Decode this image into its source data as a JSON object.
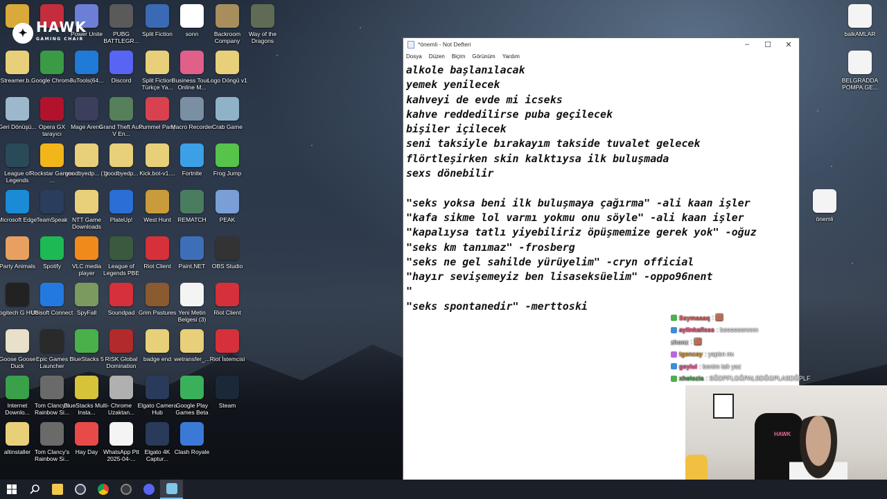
{
  "brand": {
    "logo_text": "HAWK",
    "logo_sub": "GAMING CHAIR"
  },
  "desktop": {
    "icons": [
      {
        "id": "i01",
        "label": "",
        "color": "#d9a93a"
      },
      {
        "id": "i02",
        "label": "",
        "color": "#c42d3b"
      },
      {
        "id": "i03",
        "label": "Power Unite",
        "color": "#6b7fd6"
      },
      {
        "id": "i04",
        "label": "PUBG BATTLEGR...",
        "color": "#5a5a5a"
      },
      {
        "id": "i05",
        "label": "Split Fiction",
        "color": "#3a6ab3"
      },
      {
        "id": "i06",
        "label": "sonn",
        "color": "#ffffff"
      },
      {
        "id": "i07",
        "label": "Backroom Company",
        "color": "#a78e5c"
      },
      {
        "id": "i08",
        "label": "Way of the Dragons",
        "color": "#5f6b55"
      },
      {
        "id": "i09",
        "label": "Streamer.b...",
        "color": "#e8d07a"
      },
      {
        "id": "i10",
        "label": "Google Chrome",
        "color": "#3b9a45"
      },
      {
        "id": "i11",
        "label": "3uTools(64...",
        "color": "#1f7ad8"
      },
      {
        "id": "i12",
        "label": "Discord",
        "color": "#5865f2"
      },
      {
        "id": "i13",
        "label": "Split Fiction Türkçe Ya...",
        "color": "#e8d07a"
      },
      {
        "id": "i14",
        "label": "Business Tour - Online M...",
        "color": "#e0608a"
      },
      {
        "id": "i15",
        "label": "Logo Döngü v1",
        "color": "#e8d07a"
      },
      {
        "id": "i16",
        "label": "Geri Dönüşü...",
        "color": "#9db8cc"
      },
      {
        "id": "i17",
        "label": "Opera GX tarayıcı",
        "color": "#b3122c"
      },
      {
        "id": "i18",
        "label": "Mage Arena",
        "color": "#3b3f5c"
      },
      {
        "id": "i19",
        "label": "Grand Theft Auto V En...",
        "color": "#55805a"
      },
      {
        "id": "i20",
        "label": "Pummel Party",
        "color": "#d8424f"
      },
      {
        "id": "i21",
        "label": "Macro Recorder",
        "color": "#7b8fa3"
      },
      {
        "id": "i22",
        "label": "Crab Game",
        "color": "#8fb2c9"
      },
      {
        "id": "i23",
        "label": "League of Legends",
        "color": "#2b4a59"
      },
      {
        "id": "i24",
        "label": "Rockstar Games ...",
        "color": "#f2b61a"
      },
      {
        "id": "i25",
        "label": "goodbyedp... (1)",
        "color": "#e8d07a"
      },
      {
        "id": "i26",
        "label": "goodbyedp...",
        "color": "#e8d07a"
      },
      {
        "id": "i27",
        "label": "Kick.bot-v1....",
        "color": "#e8d07a"
      },
      {
        "id": "i28",
        "label": "Fortnite",
        "color": "#3ca0e6"
      },
      {
        "id": "i29",
        "label": "Frog Jump",
        "color": "#56c34a"
      },
      {
        "id": "i30",
        "label": "Microsoft Edge",
        "color": "#1a8bd6"
      },
      {
        "id": "i31",
        "label": "TeamSpeak",
        "color": "#2a3d5c"
      },
      {
        "id": "i32",
        "label": "NTT Game Downloads",
        "color": "#e8d07a"
      },
      {
        "id": "i33",
        "label": "PlateUp!",
        "color": "#2b6fd6"
      },
      {
        "id": "i34",
        "label": "West Hunt",
        "color": "#c99b3a"
      },
      {
        "id": "i35",
        "label": "REMATCH",
        "color": "#4a7d5f"
      },
      {
        "id": "i36",
        "label": "PEAK",
        "color": "#7a9fd6"
      },
      {
        "id": "i37",
        "label": "Party Animals",
        "color": "#e8a060"
      },
      {
        "id": "i38",
        "label": "Spotify",
        "color": "#1db954"
      },
      {
        "id": "i39",
        "label": "VLC media player",
        "color": "#f08a1a"
      },
      {
        "id": "i40",
        "label": "League of Legends PBE",
        "color": "#3a5a3f"
      },
      {
        "id": "i41",
        "label": "Riot Client",
        "color": "#d6303a"
      },
      {
        "id": "i42",
        "label": "Paint.NET",
        "color": "#3d6fb8"
      },
      {
        "id": "i43",
        "label": "OBS Studio",
        "color": "#333333"
      },
      {
        "id": "i44",
        "label": "Logitech G HUB",
        "color": "#222222"
      },
      {
        "id": "i45",
        "label": "Ubisoft Connect",
        "color": "#2479e0"
      },
      {
        "id": "i46",
        "label": "SpyFall",
        "color": "#7a9a60"
      },
      {
        "id": "i47",
        "label": "Soundpad",
        "color": "#d6303a"
      },
      {
        "id": "i48",
        "label": "Grim Pastures",
        "color": "#8a5a30"
      },
      {
        "id": "i49",
        "label": "Yeni Metin Belgesi (3)",
        "color": "#f4f4f4"
      },
      {
        "id": "i50",
        "label": "Riot Client",
        "color": "#d6303a"
      },
      {
        "id": "i51",
        "label": "Goose Goose Duck",
        "color": "#e8e0c8"
      },
      {
        "id": "i52",
        "label": "Epic Games Launcher",
        "color": "#2a2a2a"
      },
      {
        "id": "i53",
        "label": "BlueStacks 5",
        "color": "#4ab04a"
      },
      {
        "id": "i54",
        "label": "RISK Global Domination",
        "color": "#b32a2a"
      },
      {
        "id": "i55",
        "label": "badge end",
        "color": "#e8d07a"
      },
      {
        "id": "i56",
        "label": "wetransfer_...",
        "color": "#e8d07a"
      },
      {
        "id": "i57",
        "label": "Riot İstemcisi",
        "color": "#d6303a"
      },
      {
        "id": "i58",
        "label": "Internet Downlo...",
        "color": "#3aa04a"
      },
      {
        "id": "i59",
        "label": "Tom Clancy's Rainbow Si...",
        "color": "#6a6a6a"
      },
      {
        "id": "i60",
        "label": "BlueStacks Multi-Insta...",
        "color": "#d6c33a"
      },
      {
        "id": "i61",
        "label": "Chrome Uzaktan...",
        "color": "#b0b0b0"
      },
      {
        "id": "i62",
        "label": "Elgato Camera Hub",
        "color": "#2a3a5a"
      },
      {
        "id": "i63",
        "label": "Google Play Games Beta",
        "color": "#3ab05a"
      },
      {
        "id": "i64",
        "label": "Steam",
        "color": "#1b2838"
      },
      {
        "id": "i65",
        "label": "altinstaller",
        "color": "#e8d07a"
      },
      {
        "id": "i66",
        "label": "Tom Clancy's Rainbow Si...",
        "color": "#6a6a6a"
      },
      {
        "id": "i67",
        "label": "Hay Day",
        "color": "#e84a4a"
      },
      {
        "id": "i68",
        "label": "WhatsApp Ptt 2025-04-...",
        "color": "#f4f4f4"
      },
      {
        "id": "i69",
        "label": "Elgato 4K Captur...",
        "color": "#2a3a5a"
      },
      {
        "id": "i70",
        "label": "Clash Royale",
        "color": "#3a7ad6"
      },
      {
        "id": "r1",
        "label": "balkAMLAR",
        "color": "#f4f4f4"
      },
      {
        "id": "r2",
        "label": "BELGRADDA POMPA.GE...",
        "color": "#f4f4f4"
      },
      {
        "id": "r3",
        "label": "önemli",
        "color": "#f4f4f4"
      }
    ]
  },
  "notepad": {
    "title": "*önemli - Not Defteri",
    "menu": [
      "Dosya",
      "Düzen",
      "Biçim",
      "Görünüm",
      "Yardım"
    ],
    "lines": [
      "alkole başlanılacak",
      "yemek yenilecek",
      "kahveyi de evde mi icseks",
      "kahve reddedilirse puba geçilecek",
      "bişiler içilecek",
      "seni taksiyle bırakayım takside tuvalet gelecek",
      "flörtleşirken skin kalktıysa ilk buluşmada",
      "sexs dönebilir",
      "",
      "\"seks yoksa beni ilk buluşmaya çağırma\" -ali kaan işler",
      "\"kafa sikme lol varmı yokmu onu söyle\" -ali kaan işler",
      "\"kapalıysa tatlı yiyebiliriz öpüşmemize gerek yok\" -oğuz",
      "\"seks km tanımaz\" -frosberg",
      "\"seks ne gel sahilde yürüyelim\" -cryn official",
      "\"hayır sevişemeyiz ben lisaseksüelim\" -oppo96nent",
      "\"",
      "\"seks spontanedir\" -merttoski"
    ]
  },
  "chat": {
    "messages": [
      {
        "user": "Ssymaaaq",
        "text": ": 🟫",
        "color": "#ff5b5b",
        "badge": "#4caf50"
      },
      {
        "user": "aylinkaflsss",
        "text": ": beeeeeennnn",
        "color": "#ff4f7a",
        "badge": "#3b8fd6"
      },
      {
        "user": "zhonz",
        "text": ": 🟫",
        "color": "#cccccc",
        "badge": ""
      },
      {
        "user": "tgencay",
        "text": ": yaptın mı",
        "color": "#f0a020",
        "badge": "#b76bd6"
      },
      {
        "user": "geylul",
        "text": ": benim lafı yaz",
        "color": "#ff5b9b",
        "badge": "#3b8fd6"
      },
      {
        "user": "xhelozia",
        "text": ": SĞDPFLGĞPALSDĞGPLASDĞPLF",
        "color": "#4caf50",
        "badge": "#4caf50"
      }
    ]
  },
  "taskbar": {
    "items": [
      "start-icon",
      "search-icon",
      "file-explorer-icon",
      "obs-icon",
      "chrome-icon",
      "app-icon",
      "opera-gx-icon",
      "notepad-icon"
    ]
  }
}
